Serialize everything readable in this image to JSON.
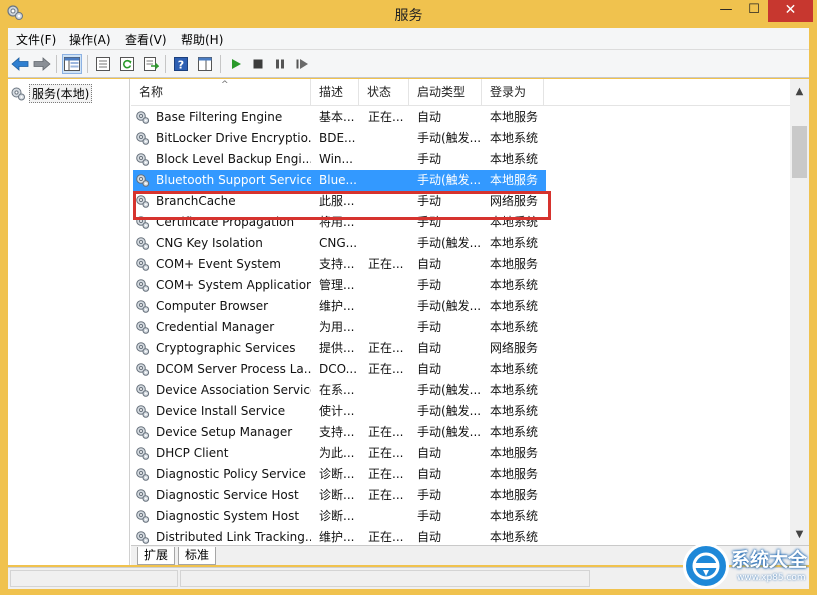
{
  "window": {
    "title": "服务",
    "minimize": "—",
    "maximize": "☐",
    "close": "✕"
  },
  "menu": [
    "文件(F)",
    "操作(A)",
    "查看(V)",
    "帮助(H)"
  ],
  "tree": {
    "root_label": "服务(本地)"
  },
  "columns": [
    "名称",
    "描述",
    "状态",
    "启动类型",
    "登录为"
  ],
  "services": [
    {
      "name": "Base Filtering Engine",
      "desc": "基本...",
      "status": "正在...",
      "startup": "自动",
      "logon": "本地服务"
    },
    {
      "name": "BitLocker Drive Encryptio...",
      "desc": "BDE...",
      "status": "",
      "startup": "手动(触发...",
      "logon": "本地系统"
    },
    {
      "name": "Block Level Backup Engi...",
      "desc": "Win...",
      "status": "",
      "startup": "手动",
      "logon": "本地系统"
    },
    {
      "name": "Bluetooth Support Service",
      "desc": "Blue...",
      "status": "",
      "startup": "手动(触发...",
      "logon": "本地服务",
      "selected": true
    },
    {
      "name": "BranchCache",
      "desc": "此服...",
      "status": "",
      "startup": "手动",
      "logon": "网络服务"
    },
    {
      "name": "Certificate Propagation",
      "desc": "将用...",
      "status": "",
      "startup": "手动",
      "logon": "本地系统"
    },
    {
      "name": "CNG Key Isolation",
      "desc": "CNG...",
      "status": "",
      "startup": "手动(触发...",
      "logon": "本地系统"
    },
    {
      "name": "COM+ Event System",
      "desc": "支持...",
      "status": "正在...",
      "startup": "自动",
      "logon": "本地服务"
    },
    {
      "name": "COM+ System Application",
      "desc": "管理...",
      "status": "",
      "startup": "手动",
      "logon": "本地系统"
    },
    {
      "name": "Computer Browser",
      "desc": "维护...",
      "status": "",
      "startup": "手动(触发...",
      "logon": "本地系统"
    },
    {
      "name": "Credential Manager",
      "desc": "为用...",
      "status": "",
      "startup": "手动",
      "logon": "本地系统"
    },
    {
      "name": "Cryptographic Services",
      "desc": "提供...",
      "status": "正在...",
      "startup": "自动",
      "logon": "网络服务"
    },
    {
      "name": "DCOM Server Process La...",
      "desc": "DCO...",
      "status": "正在...",
      "startup": "自动",
      "logon": "本地系统"
    },
    {
      "name": "Device Association Service",
      "desc": "在系...",
      "status": "",
      "startup": "手动(触发...",
      "logon": "本地系统"
    },
    {
      "name": "Device Install Service",
      "desc": "使计...",
      "status": "",
      "startup": "手动(触发...",
      "logon": "本地系统"
    },
    {
      "name": "Device Setup Manager",
      "desc": "支持...",
      "status": "正在...",
      "startup": "手动(触发...",
      "logon": "本地系统"
    },
    {
      "name": "DHCP Client",
      "desc": "为此...",
      "status": "正在...",
      "startup": "自动",
      "logon": "本地服务"
    },
    {
      "name": "Diagnostic Policy Service",
      "desc": "诊断...",
      "status": "正在...",
      "startup": "自动",
      "logon": "本地服务"
    },
    {
      "name": "Diagnostic Service Host",
      "desc": "诊断...",
      "status": "正在...",
      "startup": "手动",
      "logon": "本地服务"
    },
    {
      "name": "Diagnostic System Host",
      "desc": "诊断...",
      "status": "",
      "startup": "手动",
      "logon": "本地系统"
    },
    {
      "name": "Distributed Link Tracking...",
      "desc": "维护...",
      "status": "正在...",
      "startup": "自动",
      "logon": "本地系统"
    }
  ],
  "tabs": [
    "扩展",
    "标准"
  ],
  "watermark": {
    "text": "系统大全",
    "url": "www.xp85.com"
  },
  "colors": {
    "selection": "#3399ff",
    "highlight_box": "#d6332e",
    "titlebar": "#f0c24e"
  }
}
